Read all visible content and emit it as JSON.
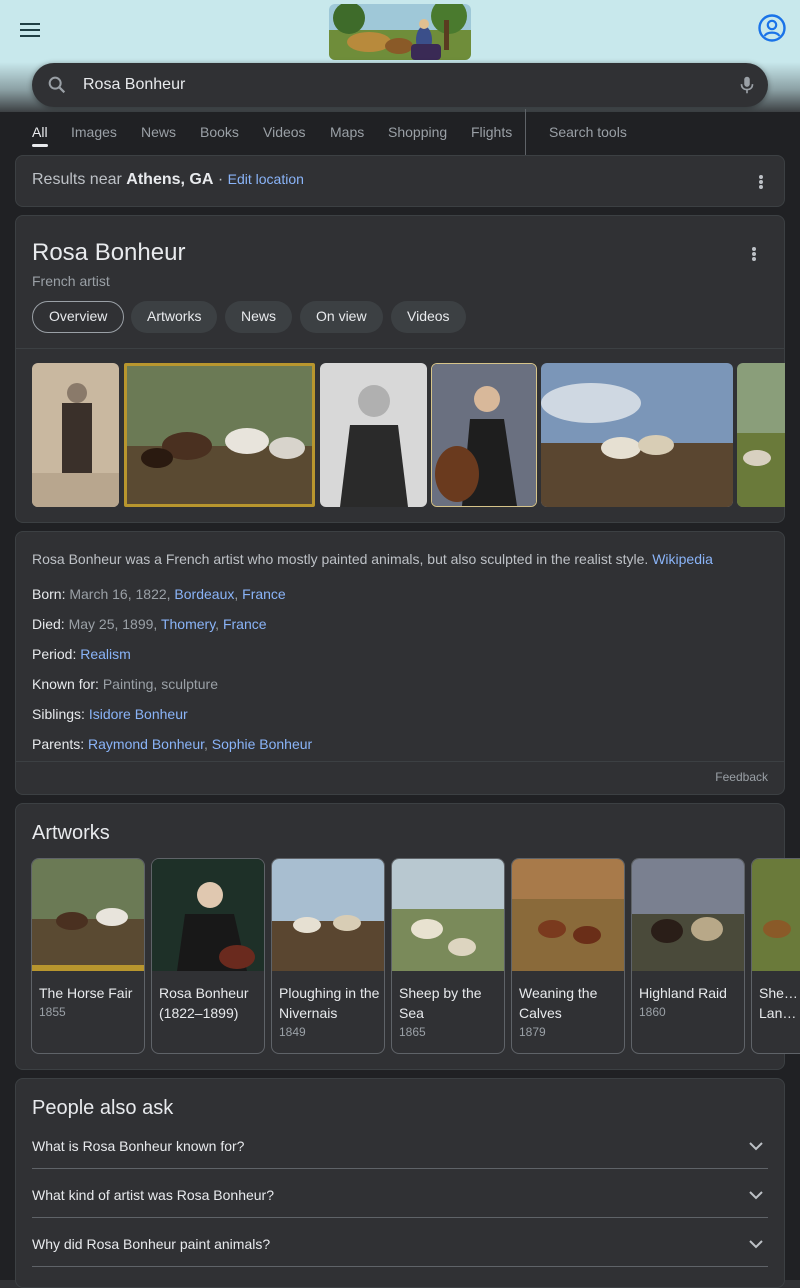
{
  "search": {
    "query": "Rosa Bonheur"
  },
  "tabs": [
    "All",
    "Images",
    "News",
    "Books",
    "Videos",
    "Maps",
    "Shopping",
    "Flights",
    "Search tools"
  ],
  "location": {
    "prefix": "Results near",
    "place": "Athens, GA",
    "sep": "·",
    "edit": "Edit location"
  },
  "kp": {
    "title": "Rosa Bonheur",
    "subtitle": "French artist",
    "chips": [
      "Overview",
      "Artworks",
      "News",
      "On view",
      "Videos"
    ]
  },
  "about": {
    "text": "Rosa Bonheur was a French artist who mostly painted animals, but also sculpted in the realist style.",
    "source": "Wikipedia",
    "facts": {
      "born_label": "Born:",
      "born_value": "March 16, 1822,",
      "born_link1": "Bordeaux",
      "born_link2": "France",
      "died_label": "Died:",
      "died_value": "May 25, 1899,",
      "died_link1": "Thomery",
      "died_link2": "France",
      "period_label": "Period:",
      "period_link": "Realism",
      "known_label": "Known for:",
      "known_value": "Painting, sculpture",
      "siblings_label": "Siblings:",
      "siblings_link": "Isidore Bonheur",
      "parents_label": "Parents:",
      "parents_link1": "Raymond Bonheur",
      "parents_link2": "Sophie Bonheur"
    },
    "feedback": "Feedback"
  },
  "artworks": {
    "title": "Artworks",
    "items": [
      {
        "name": "The Horse Fair",
        "year": "1855"
      },
      {
        "name": "Rosa Bonheur (1822–1899)",
        "year": ""
      },
      {
        "name": "Ploughing in the Nivernais",
        "year": "1849"
      },
      {
        "name": "Sheep by the Sea",
        "year": "1865"
      },
      {
        "name": "Weaning the Calves",
        "year": "1879"
      },
      {
        "name": "Highland Raid",
        "year": "1860"
      },
      {
        "name": "She… Lan…",
        "year": ""
      }
    ]
  },
  "paa": {
    "title": "People also ask",
    "questions": [
      "What is Rosa Bonheur known for?",
      "What kind of artist was Rosa Bonheur?",
      "Why did Rosa Bonheur paint animals?"
    ]
  }
}
